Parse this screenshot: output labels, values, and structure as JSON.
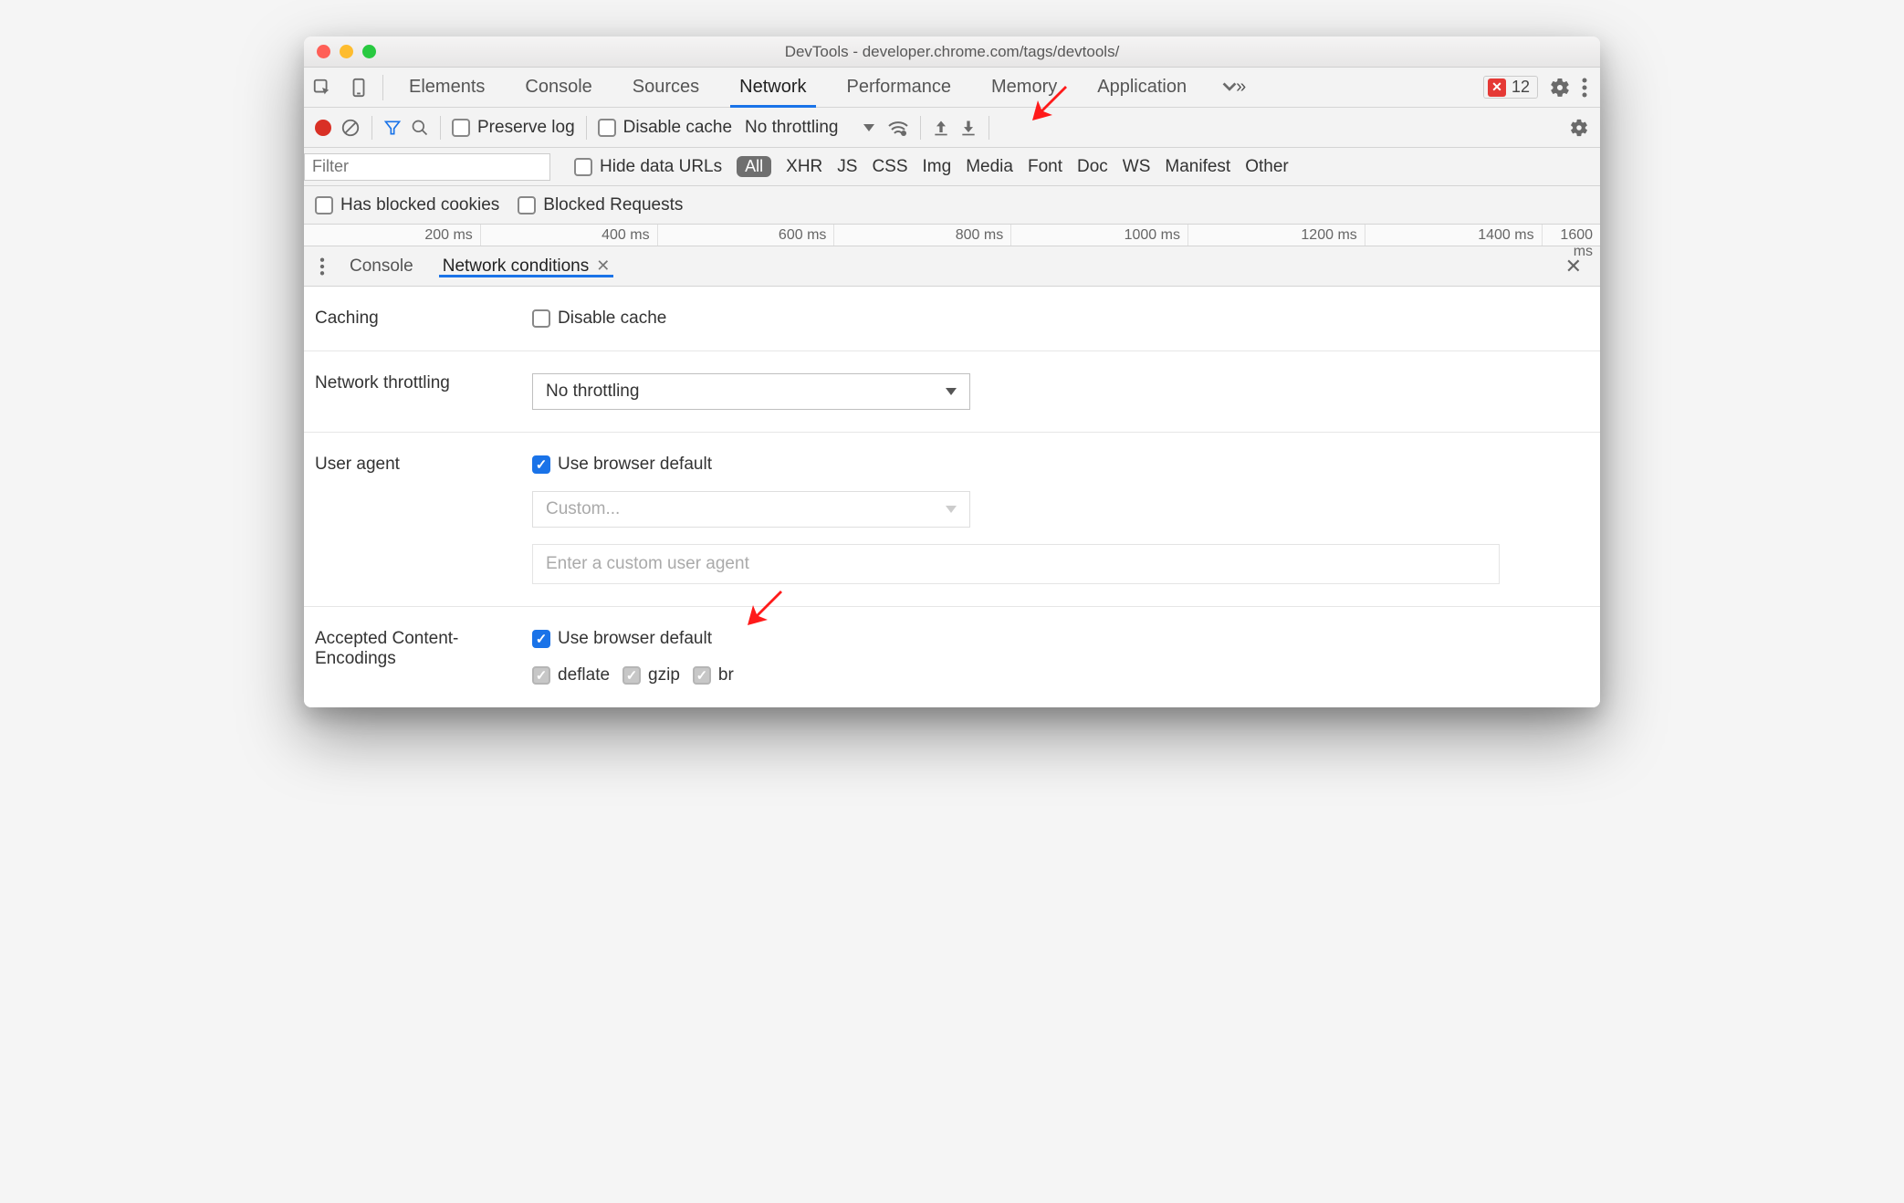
{
  "window_title": "DevTools - developer.chrome.com/tags/devtools/",
  "tabs": [
    "Elements",
    "Console",
    "Sources",
    "Network",
    "Performance",
    "Memory",
    "Application"
  ],
  "active_tab": "Network",
  "error_count": "12",
  "net_toolbar": {
    "preserve_log": "Preserve log",
    "disable_cache": "Disable cache",
    "throttling": "No throttling"
  },
  "filter": {
    "placeholder": "Filter",
    "hide_data_urls": "Hide data URLs",
    "all": "All",
    "types": [
      "XHR",
      "JS",
      "CSS",
      "Img",
      "Media",
      "Font",
      "Doc",
      "WS",
      "Manifest",
      "Other"
    ]
  },
  "cookie_row": {
    "has_blocked_cookies": "Has blocked cookies",
    "blocked_requests": "Blocked Requests"
  },
  "waterfall_ticks": [
    "200 ms",
    "400 ms",
    "600 ms",
    "800 ms",
    "1000 ms",
    "1200 ms",
    "1400 ms",
    "1600 ms"
  ],
  "drawer": {
    "tabs": [
      "Console",
      "Network conditions"
    ],
    "active": "Network conditions"
  },
  "settings": {
    "caching": {
      "label": "Caching",
      "disable_cache": "Disable cache"
    },
    "throttling": {
      "label": "Network throttling",
      "value": "No throttling"
    },
    "ua": {
      "label": "User agent",
      "use_browser_default": "Use browser default",
      "custom_placeholder": "Custom...",
      "custom_input_placeholder": "Enter a custom user agent"
    },
    "encodings": {
      "label": "Accepted Content-Encodings",
      "use_browser_default": "Use browser default",
      "options": [
        "deflate",
        "gzip",
        "br"
      ]
    }
  }
}
